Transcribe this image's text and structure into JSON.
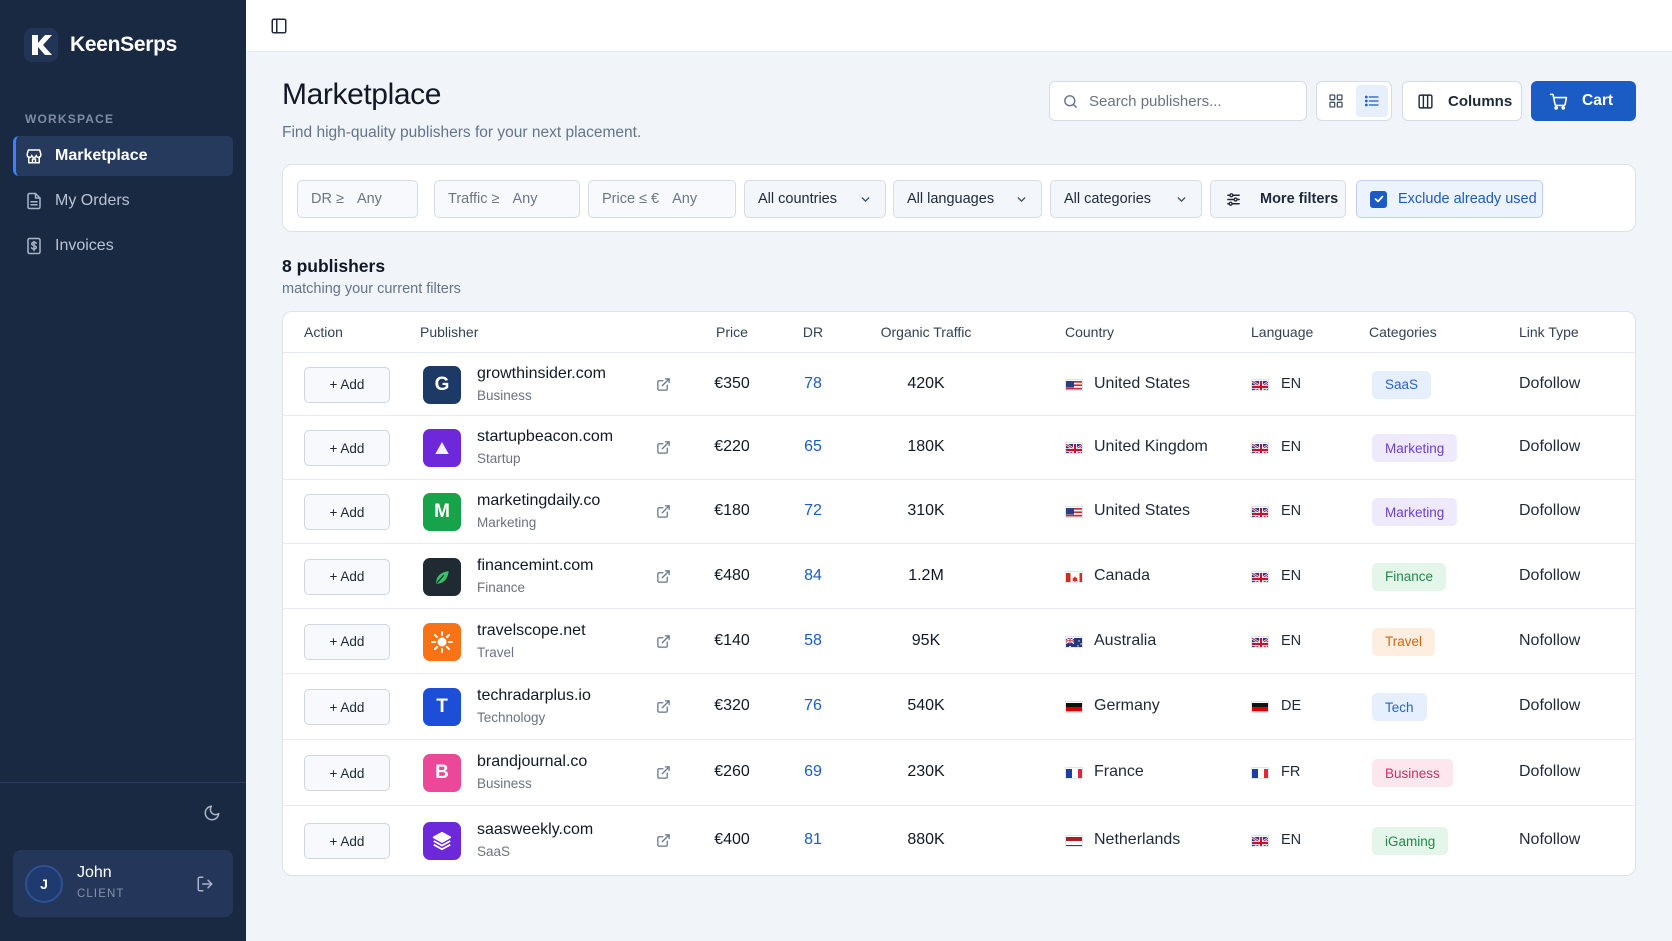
{
  "brand": {
    "name": "KeenSerps",
    "logo_letter": "K"
  },
  "sidebar": {
    "section_label": "WORKSPACE",
    "items": [
      {
        "label": "Marketplace",
        "icon": "store-icon",
        "active": true
      },
      {
        "label": "My Orders",
        "icon": "document-icon",
        "active": false
      },
      {
        "label": "Invoices",
        "icon": "receipt-icon",
        "active": false
      }
    ],
    "user": {
      "initial": "J",
      "name": "John",
      "role": "CLIENT"
    }
  },
  "header": {
    "title": "Marketplace",
    "subtitle": "Find high-quality publishers for your next placement.",
    "search_placeholder": "Search publishers...",
    "columns_label": "Columns",
    "cart_label": "Cart"
  },
  "filters": {
    "dr": {
      "label": "DR ≥",
      "value": "Any"
    },
    "traffic": {
      "label": "Traffic ≥",
      "value": "Any"
    },
    "price": {
      "label": "Price ≤ €",
      "value": "Any"
    },
    "countries": "All countries",
    "languages": "All languages",
    "categories": "All categories",
    "more_filters": "More filters",
    "exclude_used": {
      "label": "Exclude already used",
      "checked": true
    }
  },
  "results": {
    "count_text": "8 publishers",
    "sub_text": "matching your current filters"
  },
  "table": {
    "columns": [
      "Action",
      "Publisher",
      "Price",
      "DR",
      "Organic Traffic",
      "Country",
      "Language",
      "Categories",
      "Link Type"
    ],
    "add_label": "+ Add",
    "rows": [
      {
        "domain": "growthinsider.com",
        "category": "Business",
        "logo": "G",
        "logo_color": "#1d3a66",
        "price": "€350",
        "dr": "78",
        "traffic": "420K",
        "country": "United States",
        "country_flag": "us",
        "lang": "EN",
        "lang_flag": "gb",
        "badge": "SaaS",
        "badge_bg": "#e6effd",
        "badge_fg": "#2a62c9",
        "link_type": "Dofollow"
      },
      {
        "domain": "startupbeacon.com",
        "category": "Startup",
        "logo": "▲",
        "logo_color": "#6d28d9",
        "price": "€220",
        "dr": "65",
        "traffic": "180K",
        "country": "United Kingdom",
        "country_flag": "gb",
        "lang": "EN",
        "lang_flag": "gb",
        "badge": "Marketing",
        "badge_bg": "#efe9fd",
        "badge_fg": "#6d3fc9",
        "link_type": "Dofollow"
      },
      {
        "domain": "marketingdaily.co",
        "category": "Marketing",
        "logo": "M",
        "logo_color": "#16a34a",
        "price": "€180",
        "dr": "72",
        "traffic": "310K",
        "country": "United States",
        "country_flag": "us",
        "lang": "EN",
        "lang_flag": "gb",
        "badge": "Marketing",
        "badge_bg": "#efe9fd",
        "badge_fg": "#6d3fc9",
        "link_type": "Dofollow"
      },
      {
        "domain": "financemint.com",
        "category": "Finance",
        "logo": "leaf",
        "logo_color": "#1f2a33",
        "price": "€480",
        "dr": "84",
        "traffic": "1.2M",
        "country": "Canada",
        "country_flag": "ca",
        "lang": "EN",
        "lang_flag": "gb",
        "badge": "Finance",
        "badge_bg": "#e4f6ea",
        "badge_fg": "#1f8a4c",
        "link_type": "Dofollow"
      },
      {
        "domain": "travelscope.net",
        "category": "Travel",
        "logo": "sun",
        "logo_color": "#f97316",
        "price": "€140",
        "dr": "58",
        "traffic": "95K",
        "country": "Australia",
        "country_flag": "au",
        "lang": "EN",
        "lang_flag": "gb",
        "badge": "Travel",
        "badge_bg": "#fdeee0",
        "badge_fg": "#d1670f",
        "link_type": "Nofollow"
      },
      {
        "domain": "techradarplus.io",
        "category": "Technology",
        "logo": "T",
        "logo_color": "#1d4ed8",
        "price": "€320",
        "dr": "76",
        "traffic": "540K",
        "country": "Germany",
        "country_flag": "de",
        "lang": "DE",
        "lang_flag": "de",
        "badge": "Tech",
        "badge_bg": "#e6effd",
        "badge_fg": "#2a62c9",
        "link_type": "Dofollow"
      },
      {
        "domain": "brandjournal.co",
        "category": "Business",
        "logo": "B",
        "logo_color": "#ec4899",
        "price": "€260",
        "dr": "69",
        "traffic": "230K",
        "country": "France",
        "country_flag": "fr",
        "lang": "FR",
        "lang_flag": "fr",
        "badge": "Business",
        "badge_bg": "#fde7ee",
        "badge_fg": "#cf2f66",
        "link_type": "Dofollow"
      },
      {
        "domain": "saasweekly.com",
        "category": "SaaS",
        "logo": "layers",
        "logo_color": "#6d28d9",
        "price": "€400",
        "dr": "81",
        "traffic": "880K",
        "country": "Netherlands",
        "country_flag": "nl",
        "lang": "EN",
        "lang_flag": "gb",
        "badge": "iGaming",
        "badge_bg": "#e4f6ea",
        "badge_fg": "#1f8a4c",
        "link_type": "Nofollow"
      }
    ]
  }
}
